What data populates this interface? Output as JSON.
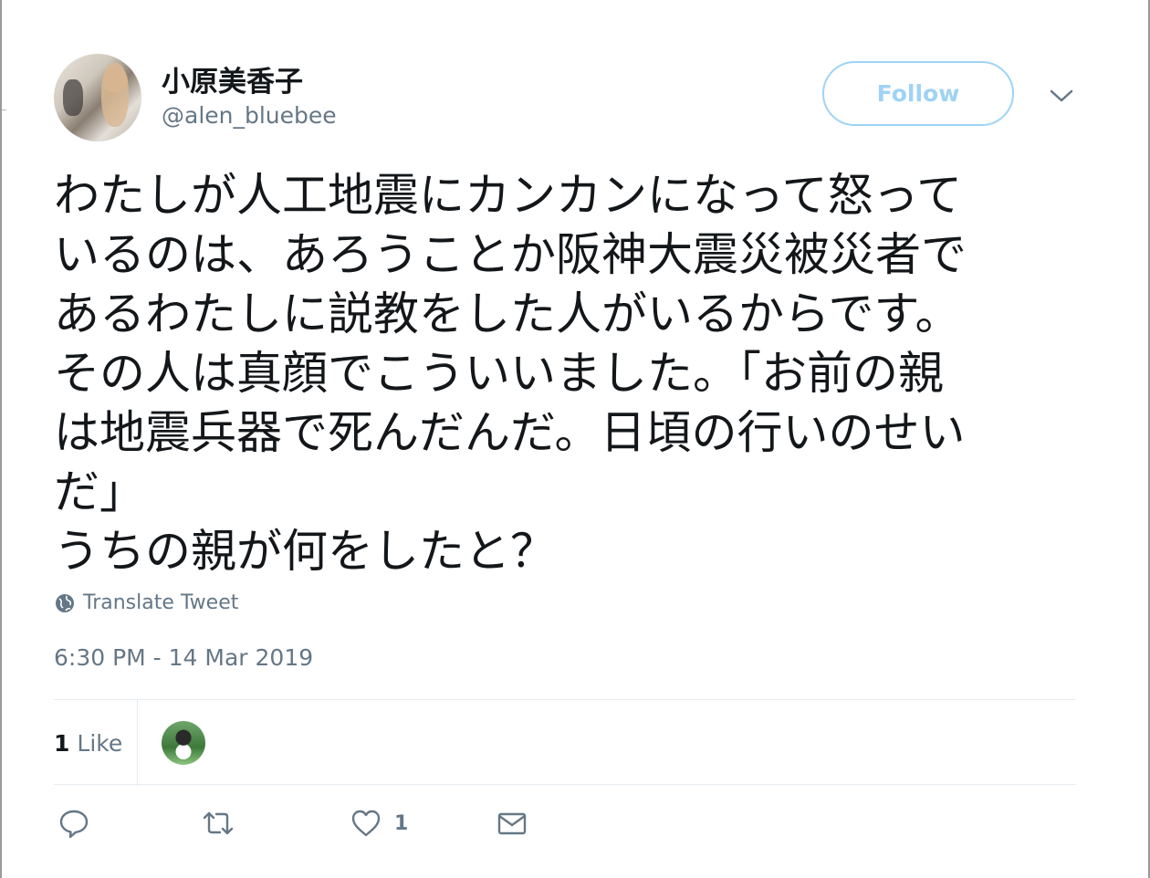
{
  "tweet": {
    "display_name": "小原美香子",
    "handle": "@alen_bluebee",
    "follow_label": "Follow",
    "text": "わたしが人工地震にカンカンになって怒って\nいるのは、あろうことか阪神大震災被災者で\nあるわたしに説教をした人がいるからです。\nその人は真顔でこういいました。「お前の親\nは地震兵器で死んだんだ。日頃の行いのせい\nだ」\nうちの親が何をしたと？",
    "translate_label": "Translate Tweet",
    "timestamp": "6:30 PM - 14 Mar 2019"
  },
  "stats": {
    "likes_count": "1",
    "likes_label": "Like"
  },
  "actions": {
    "like_count": "1"
  },
  "icons": {
    "caret": "chevron-down-icon",
    "globe": "globe-icon",
    "reply": "reply-icon",
    "retweet": "retweet-icon",
    "like": "heart-icon",
    "dm": "envelope-icon"
  },
  "colors": {
    "follow_accent": "#9fd3f5",
    "secondary_text": "#657786"
  }
}
